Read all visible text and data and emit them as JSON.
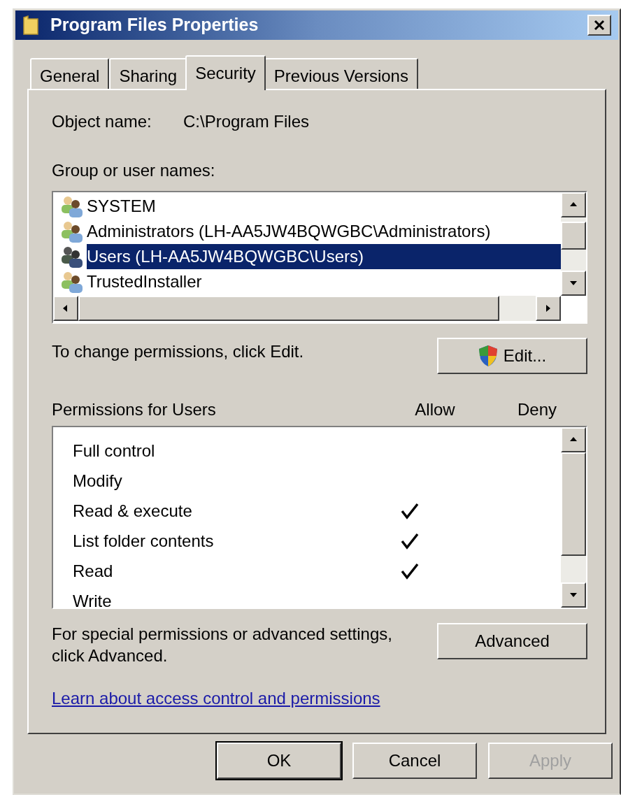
{
  "window": {
    "title": "Program Files Properties"
  },
  "tabs": [
    {
      "label": "General",
      "selected": false
    },
    {
      "label": "Sharing",
      "selected": false
    },
    {
      "label": "Security",
      "selected": true
    },
    {
      "label": "Previous Versions",
      "selected": false
    }
  ],
  "object_name": {
    "label": "Object name:",
    "value": "C:\\Program Files"
  },
  "group_label": "Group or user names:",
  "users": [
    {
      "name": "SYSTEM",
      "selected": false
    },
    {
      "name": "Administrators (LH-AA5JW4BQWGBC\\Administrators)",
      "selected": false
    },
    {
      "name": "Users (LH-AA5JW4BQWGBC\\Users)",
      "selected": true
    },
    {
      "name": "TrustedInstaller",
      "selected": false
    }
  ],
  "change_hint": "To change permissions, click Edit.",
  "edit_button": "Edit...",
  "permissions": {
    "title": "Permissions for Users",
    "allow_label": "Allow",
    "deny_label": "Deny",
    "rows": [
      {
        "name": "Full control",
        "allow": false
      },
      {
        "name": "Modify",
        "allow": false
      },
      {
        "name": "Read & execute",
        "allow": true
      },
      {
        "name": "List folder contents",
        "allow": true
      },
      {
        "name": "Read",
        "allow": true
      },
      {
        "name": "Write",
        "allow": false
      }
    ]
  },
  "advanced_hint": "For special permissions or advanced settings, click Advanced.",
  "advanced_button": "Advanced",
  "link": "Learn about access control and permissions",
  "buttons": [
    {
      "label": "OK",
      "default": true,
      "disabled": false
    },
    {
      "label": "Cancel",
      "default": false,
      "disabled": false
    },
    {
      "label": "Apply",
      "default": false,
      "disabled": true
    }
  ]
}
